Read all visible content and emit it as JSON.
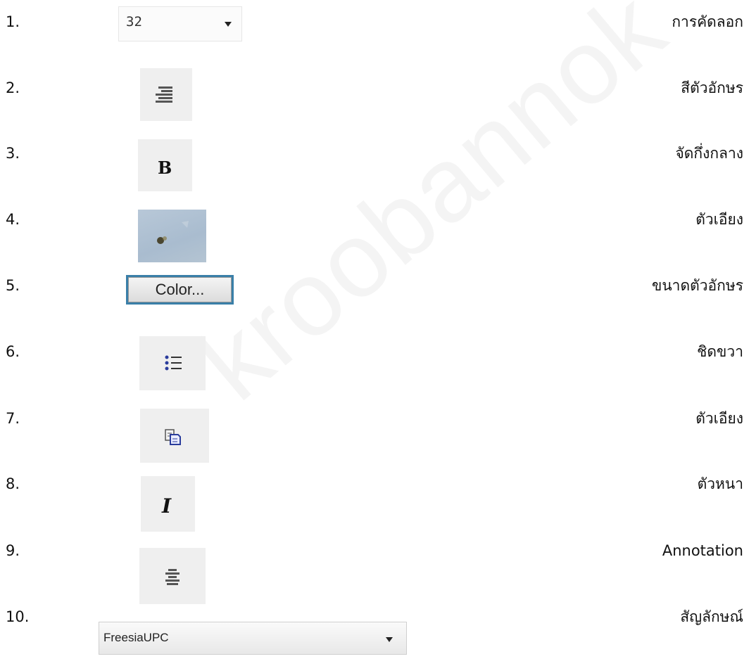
{
  "watermark": "kroobannok",
  "rows": [
    {
      "number": "1.",
      "label": "การคัดลอก"
    },
    {
      "number": "2.",
      "label": "สีตัวอักษร"
    },
    {
      "number": "3.",
      "label": "จัดกึ่งกลาง"
    },
    {
      "number": "4.",
      "label": "ตัวเอียง"
    },
    {
      "number": "5.",
      "label": "ขนาดตัวอักษร"
    },
    {
      "number": "6.",
      "label": "ชิดขวา"
    },
    {
      "number": "7.",
      "label": "ตัวเอียง"
    },
    {
      "number": "8.",
      "label": "ตัวหนา"
    },
    {
      "number": "9.",
      "label": "Annotation"
    },
    {
      "number": "10.",
      "label": "สัญลักษณ์"
    }
  ],
  "widgets": {
    "size_dropdown_value": "32",
    "bold_glyph": "B",
    "italic_glyph": "I",
    "color_button_label": "Color...",
    "font_dropdown_value": "FreesiaUPC"
  },
  "icons": [
    "chevron-down-icon",
    "align-right-icon",
    "bold-icon",
    "color-picker-icon",
    "bullet-list-icon",
    "copy-icon",
    "italic-icon",
    "align-center-icon"
  ],
  "colors": {
    "watermark": "#d8d8d8",
    "color_button_border": "#3a7fa8",
    "list_bullet": "#2a3c9c"
  }
}
